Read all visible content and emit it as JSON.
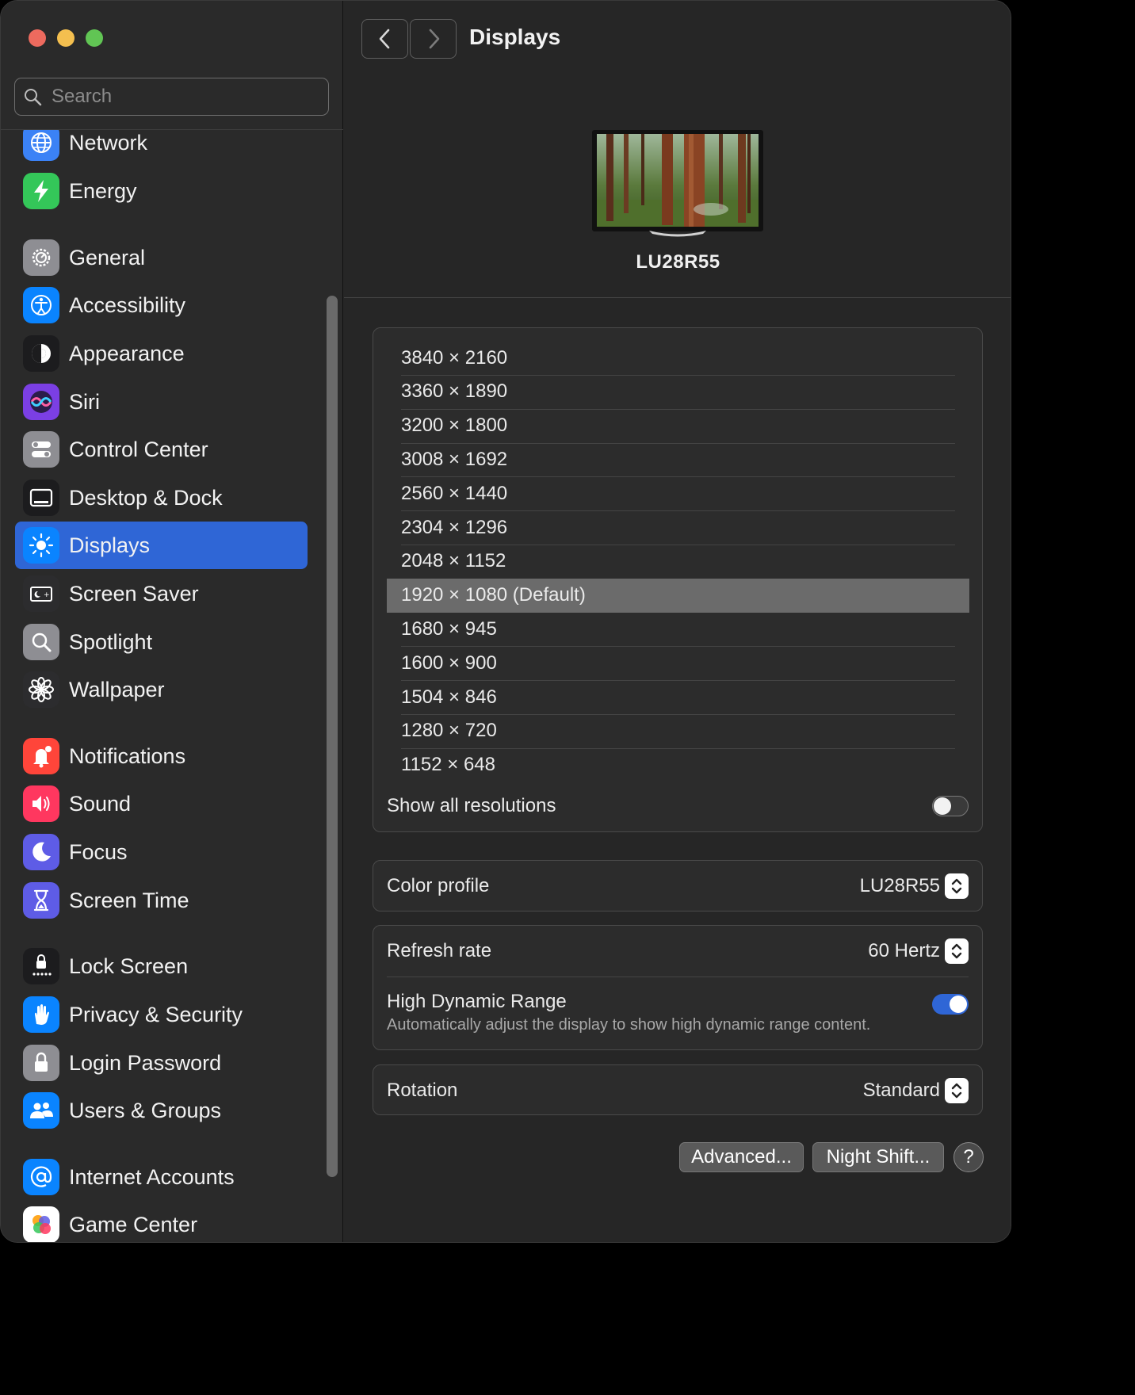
{
  "search": {
    "placeholder": "Search"
  },
  "sidebar": {
    "items": [
      {
        "label": "Network",
        "icon": "globe-icon",
        "color": "#3b82f6"
      },
      {
        "label": "Energy",
        "icon": "bolt-icon",
        "color": "#34c759"
      },
      {
        "label": "General",
        "icon": "gear-icon",
        "color": "#8e8e93"
      },
      {
        "label": "Accessibility",
        "icon": "accessibility-icon",
        "color": "#0a84ff"
      },
      {
        "label": "Appearance",
        "icon": "appearance-icon",
        "color": "#1c1c1e"
      },
      {
        "label": "Siri",
        "icon": "siri-icon",
        "color": "#7b3fe4"
      },
      {
        "label": "Control Center",
        "icon": "control-center-icon",
        "color": "#8e8e93"
      },
      {
        "label": "Desktop & Dock",
        "icon": "dock-icon",
        "color": "#1c1c1e"
      },
      {
        "label": "Displays",
        "icon": "sun-icon",
        "color": "#0a84ff"
      },
      {
        "label": "Screen Saver",
        "icon": "screen-saver-icon",
        "color": "#2c2c2e"
      },
      {
        "label": "Spotlight",
        "icon": "magnifier-icon",
        "color": "#8e8e93"
      },
      {
        "label": "Wallpaper",
        "icon": "flower-icon",
        "color": "#2c2c2e"
      },
      {
        "label": "Notifications",
        "icon": "bell-icon",
        "color": "#ff453a"
      },
      {
        "label": "Sound",
        "icon": "speaker-icon",
        "color": "#ff375f"
      },
      {
        "label": "Focus",
        "icon": "moon-icon",
        "color": "#5e5ce6"
      },
      {
        "label": "Screen Time",
        "icon": "hourglass-icon",
        "color": "#5e5ce6"
      },
      {
        "label": "Lock Screen",
        "icon": "lock-screen-icon",
        "color": "#1c1c1e"
      },
      {
        "label": "Privacy & Security",
        "icon": "hand-icon",
        "color": "#0a84ff"
      },
      {
        "label": "Login Password",
        "icon": "padlock-icon",
        "color": "#8e8e93"
      },
      {
        "label": "Users & Groups",
        "icon": "users-icon",
        "color": "#0a84ff"
      },
      {
        "label": "Internet Accounts",
        "icon": "at-icon",
        "color": "#0a84ff"
      },
      {
        "label": "Game Center",
        "icon": "game-center-icon",
        "color": "#ffffff"
      }
    ],
    "selected": "Displays"
  },
  "header": {
    "title": "Displays"
  },
  "display": {
    "name": "LU28R55"
  },
  "resolutions": {
    "items": [
      "3840 × 2160",
      "3360 × 1890",
      "3200 × 1800",
      "3008 × 1692",
      "2560 × 1440",
      "2304 × 1296",
      "2048 × 1152",
      "1920 × 1080 (Default)",
      "1680 × 945",
      "1600 × 900",
      "1504 × 846",
      "1280 × 720",
      "1152 × 648"
    ],
    "selected_index": 7,
    "show_all_label": "Show all resolutions",
    "show_all_on": false
  },
  "color_profile": {
    "label": "Color profile",
    "value": "LU28R55"
  },
  "refresh": {
    "label": "Refresh rate",
    "value": "60 Hertz"
  },
  "hdr": {
    "label": "High Dynamic Range",
    "description": "Automatically adjust the display to show high dynamic range content.",
    "on": true
  },
  "rotation": {
    "label": "Rotation",
    "value": "Standard"
  },
  "buttons": {
    "advanced": "Advanced...",
    "night_shift": "Night Shift...",
    "help": "?"
  }
}
